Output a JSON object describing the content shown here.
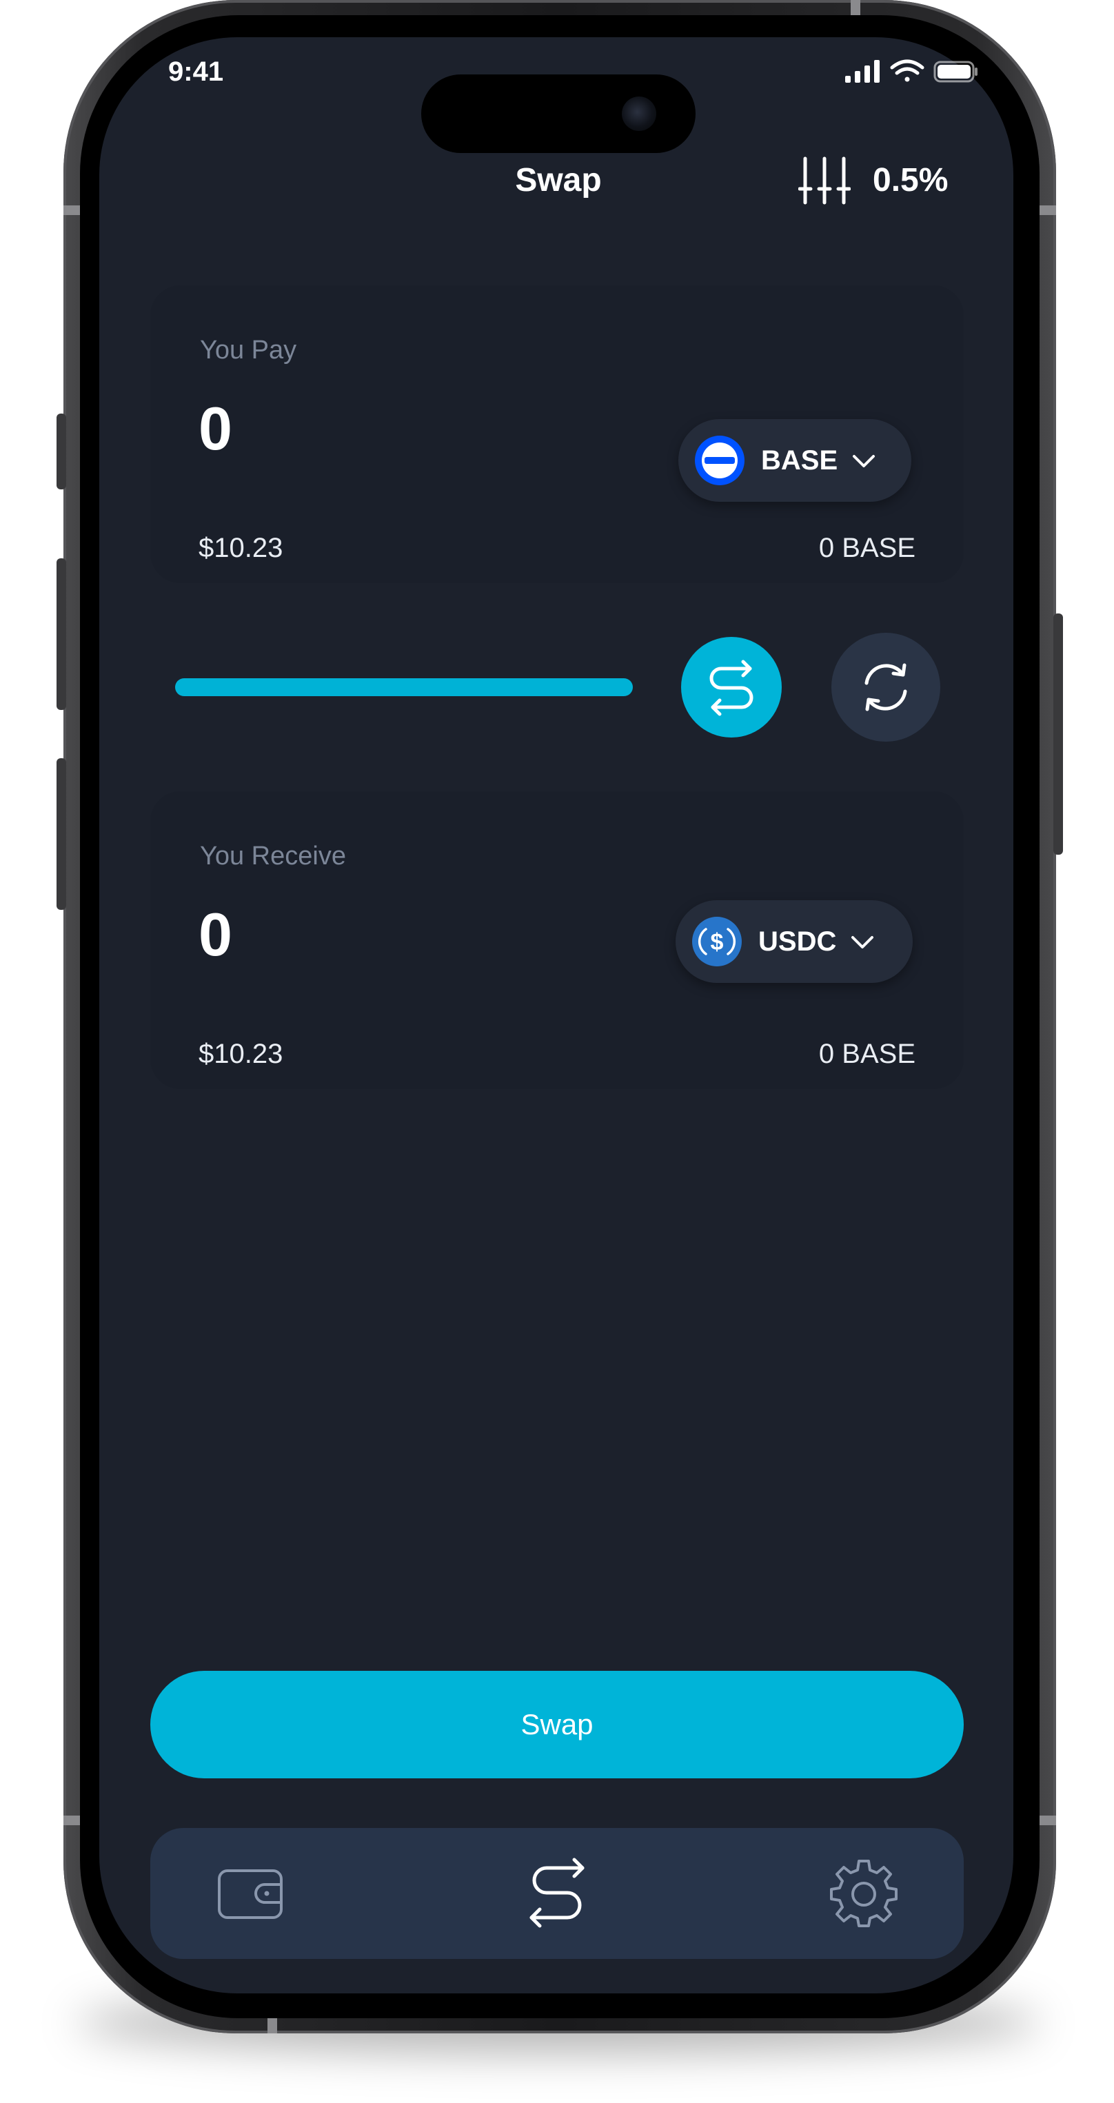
{
  "status_bar": {
    "time": "9:41",
    "icons": [
      "signal-icon",
      "wifi-icon",
      "battery-icon"
    ]
  },
  "header": {
    "title": "Swap",
    "settings_icon": "sliders-icon",
    "slippage": "0.5%"
  },
  "pay_card": {
    "label": "You Pay",
    "amount": "0",
    "fiat_value": "$10.23",
    "balance": "0 BASE",
    "token": {
      "symbol": "BASE",
      "icon": "base-token-icon",
      "color": "#0052ff"
    }
  },
  "controls": {
    "slider_fill": 1.0,
    "swap_direction_icon": "swap-arrows-icon",
    "refresh_icon": "refresh-icon"
  },
  "receive_card": {
    "label": "You Receive",
    "amount": "0",
    "fiat_value": "$10.23",
    "balance": "0 BASE",
    "token": {
      "symbol": "USDC",
      "icon": "usdc-token-icon",
      "color": "#2775ca"
    }
  },
  "actions": {
    "swap_label": "Swap"
  },
  "bottom_nav": {
    "items": [
      {
        "name": "wallet",
        "icon": "wallet-icon",
        "active": false
      },
      {
        "name": "swap",
        "icon": "swap-arrows-icon",
        "active": true
      },
      {
        "name": "settings",
        "icon": "gear-icon",
        "active": false
      }
    ]
  },
  "colors": {
    "accent": "#00b4d8",
    "background": "#1c212c",
    "card": "#1a1f2a",
    "nav": "#27344a"
  }
}
